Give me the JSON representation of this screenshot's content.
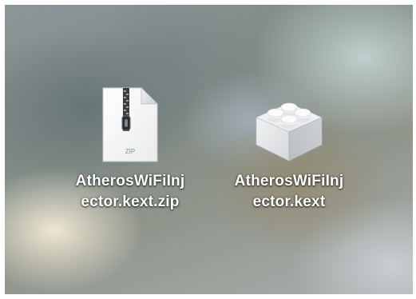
{
  "desktop": {
    "items": [
      {
        "icon": "zip-archive-icon",
        "icon_badge": "ZIP",
        "label_line1": "AtherosWiFiInj",
        "label_line2": "ector.kext.zip"
      },
      {
        "icon": "kext-bundle-icon",
        "label_line1": "AtherosWiFiInj",
        "label_line2": "ector.kext"
      }
    ]
  }
}
